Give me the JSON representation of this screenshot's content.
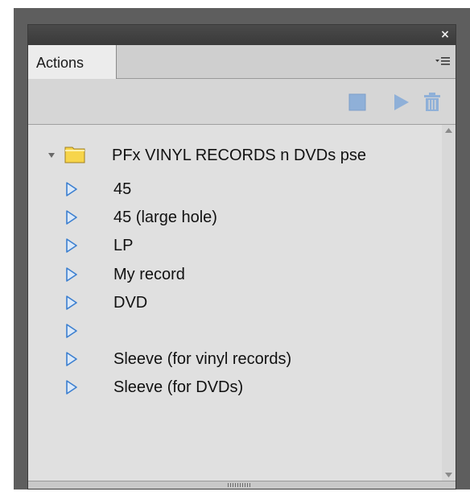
{
  "panel": {
    "close_glyph": "×",
    "tab_label": "Actions",
    "menu_icon": "panel-menu-icon"
  },
  "toolbar": {
    "stop_icon": "stop-icon",
    "play_icon": "play-icon",
    "delete_icon": "trash-icon"
  },
  "actions_list": {
    "folder": {
      "label": "PFx VINYL RECORDS n DVDs pse",
      "icon": "folder-icon",
      "expanded": true
    },
    "items": [
      {
        "label": "45"
      },
      {
        "label": "45 (large hole)"
      },
      {
        "label": "LP"
      },
      {
        "label": "My record"
      },
      {
        "label": "DVD"
      },
      {
        "label": ""
      },
      {
        "label": "Sleeve (for vinyl records)"
      },
      {
        "label": "Sleeve (for DVDs)"
      }
    ]
  },
  "colors": {
    "play_outline": "#3b7fd0",
    "play_fill": "#dce9f8",
    "toolbar_icon": "#8fb0d8",
    "folder_fill": "#f7d54a"
  }
}
